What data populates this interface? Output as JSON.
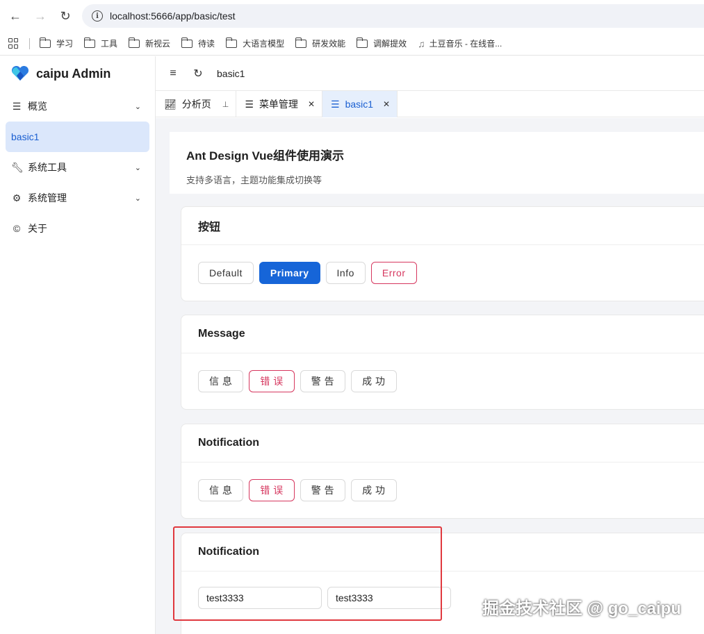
{
  "browser": {
    "url": "localhost:5666/app/basic/test",
    "bookmarks": [
      "学习",
      "工具",
      "新视云",
      "待读",
      "大语言模型",
      "研发效能",
      "调解提效",
      "土豆音乐 - 在线音..."
    ]
  },
  "app": {
    "name": "caipu Admin"
  },
  "sidebar": {
    "items": [
      {
        "label": "概览",
        "icon": "list-icon",
        "expandable": true
      },
      {
        "label": "basic1",
        "active": true
      },
      {
        "label": "系统工具",
        "icon": "wrench-icon",
        "expandable": true
      },
      {
        "label": "系统管理",
        "icon": "gear-icon",
        "expandable": true
      },
      {
        "label": "关于",
        "icon": "copyright-icon"
      }
    ]
  },
  "header": {
    "title": "basic1"
  },
  "tabs": [
    {
      "label": "分析页",
      "icon": "chart-icon",
      "pinned": true
    },
    {
      "label": "菜单管理",
      "icon": "menu-icon",
      "closable": true
    },
    {
      "label": "basic1",
      "icon": "menu-icon",
      "closable": true,
      "active": true
    }
  ],
  "page": {
    "title": "Ant Design Vue组件使用演示",
    "subtitle": "支持多语言，主题功能集成切换等"
  },
  "cards": {
    "buttons": {
      "title": "按钮",
      "items": [
        "Default",
        "Primary",
        "Info",
        "Error"
      ]
    },
    "message": {
      "title": "Message",
      "items": [
        "信 息",
        "错 误",
        "警 告",
        "成 功"
      ]
    },
    "notification": {
      "title": "Notification",
      "items": [
        "信 息",
        "错 误",
        "警 告",
        "成 功"
      ]
    },
    "notification2": {
      "title": "Notification",
      "inputs": [
        "test3333",
        "test3333"
      ]
    }
  },
  "watermark": "掘金技术社区 @ go_caipu",
  "colors": {
    "primary": "#1665d8",
    "danger": "#d6365e",
    "highlight": "#e0383e",
    "active_bg": "#dbe7fb"
  }
}
